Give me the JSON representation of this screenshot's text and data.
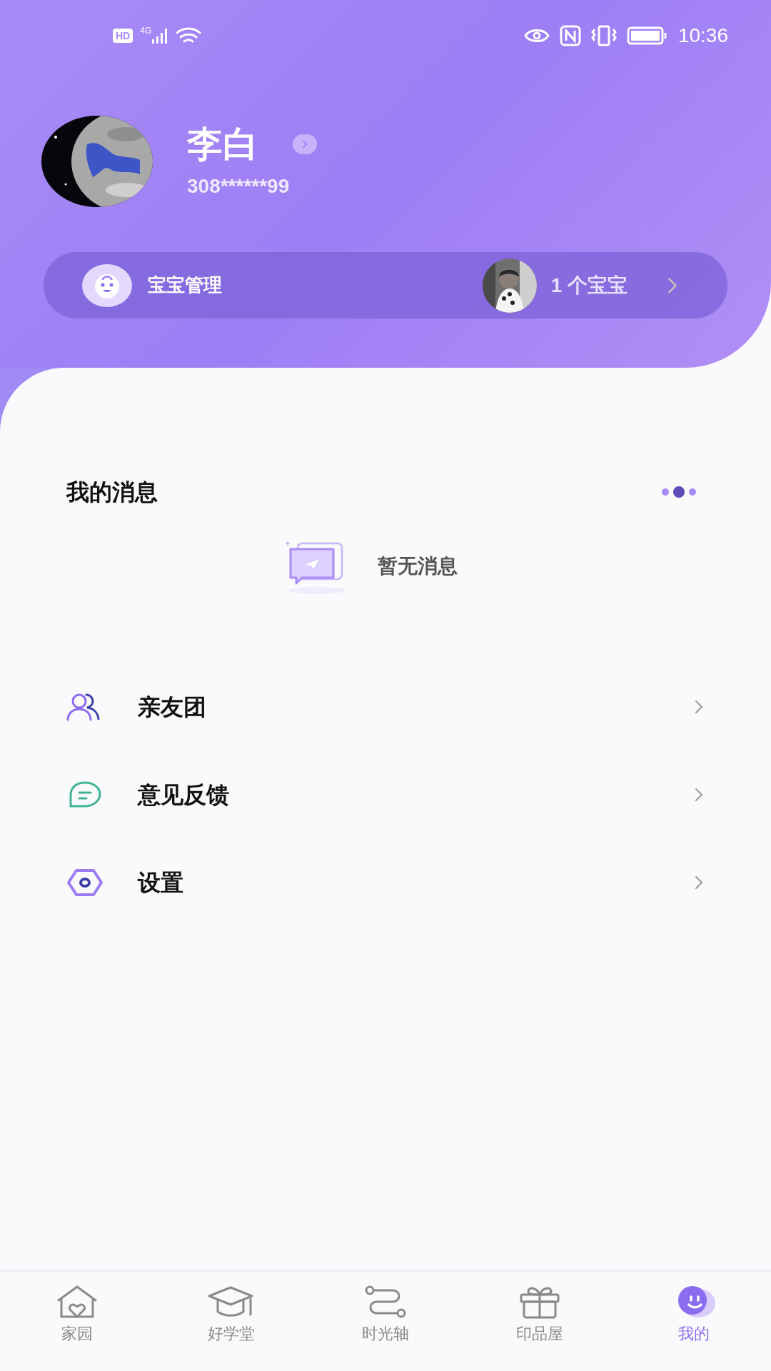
{
  "status_bar": {
    "time": "10:36",
    "hd": "HD",
    "network": "4G"
  },
  "profile": {
    "name": "李白",
    "account": "308******99"
  },
  "baby_bar": {
    "label": "宝宝管理",
    "count": "1 个宝宝"
  },
  "messages": {
    "title": "我的消息",
    "empty_text": "暂无消息",
    "pager": [
      {
        "selected": false
      },
      {
        "selected": true
      },
      {
        "selected": false
      }
    ]
  },
  "menu": [
    {
      "kind": "people",
      "label": "亲友团"
    },
    {
      "kind": "chat",
      "label": "意见反馈"
    },
    {
      "kind": "settings",
      "label": "设置"
    }
  ],
  "tabs": [
    {
      "kind": "home",
      "label": "家园",
      "selected": false
    },
    {
      "kind": "school",
      "label": "好学堂",
      "selected": false
    },
    {
      "kind": "timeline",
      "label": "时光轴",
      "selected": false
    },
    {
      "kind": "gift",
      "label": "印品屋",
      "selected": false
    },
    {
      "kind": "me",
      "label": "我的",
      "selected": true
    }
  ]
}
